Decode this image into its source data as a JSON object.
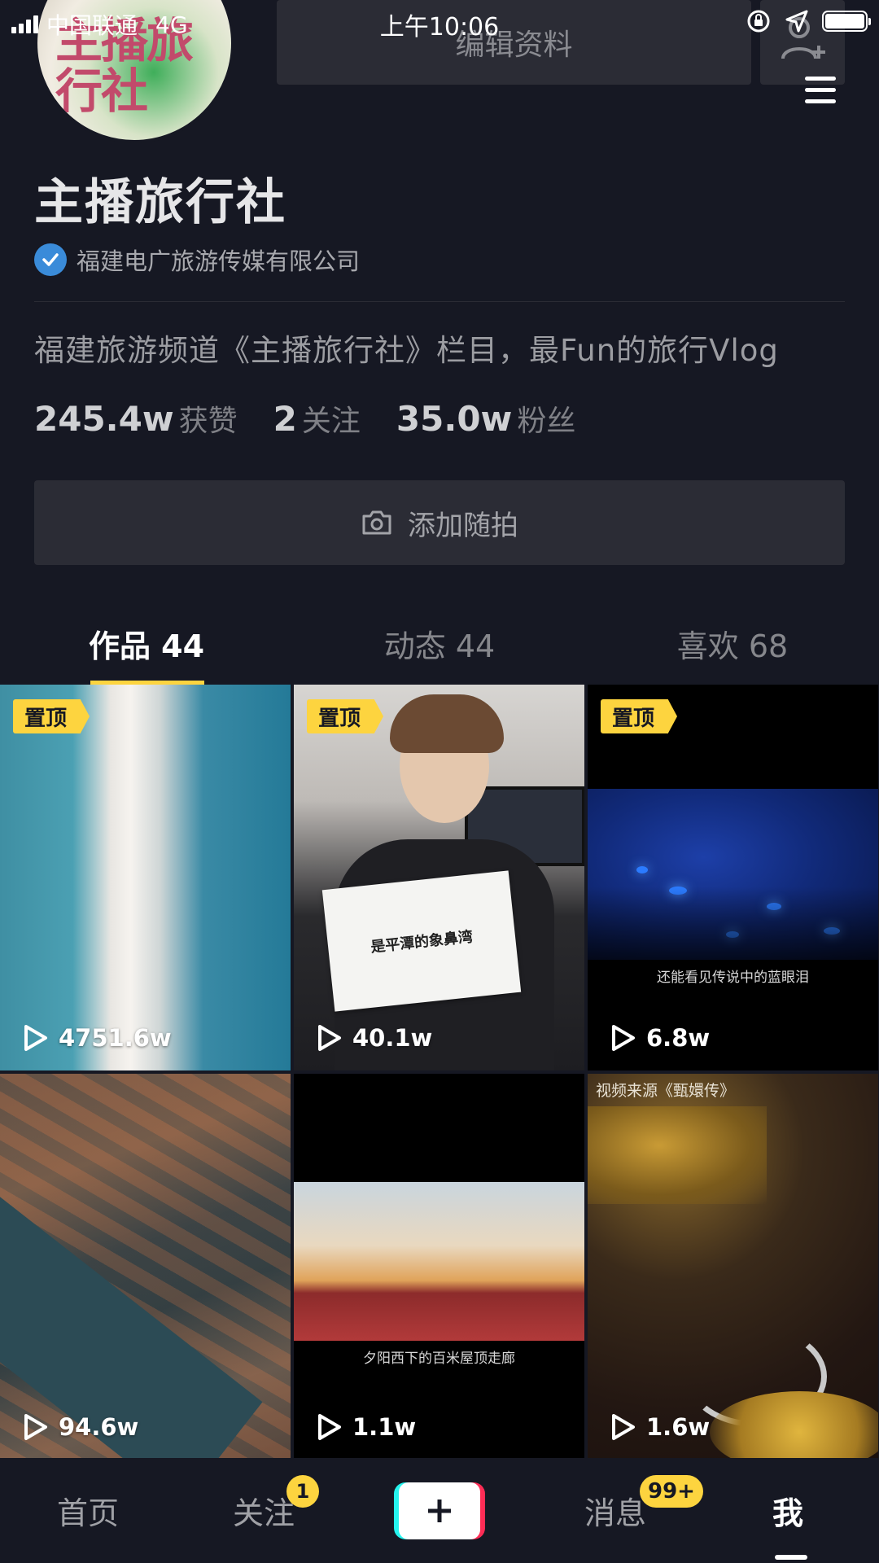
{
  "status_bar": {
    "carrier": "中国联通",
    "network": "4G",
    "time": "上午10:06"
  },
  "header": {
    "avatar_text": "主播旅行社",
    "edit_profile_label": "编辑资料",
    "add_friend_icon": "add-friend-icon",
    "menu_icon": "menu-icon"
  },
  "profile": {
    "name": "主播旅行社",
    "verified_org": "福建电广旅游传媒有限公司",
    "bio": "福建旅游频道《主播旅行社》栏目，最Fun的旅行Vlog",
    "stats": [
      {
        "value": "245.4w",
        "label": "获赞"
      },
      {
        "value": "2",
        "label": "关注"
      },
      {
        "value": "35.0w",
        "label": "粉丝"
      }
    ],
    "add_snap_label": "添加随拍"
  },
  "tabs": [
    {
      "label": "作品 44",
      "active": true
    },
    {
      "label": "动态 44",
      "active": false
    },
    {
      "label": "喜欢 68",
      "active": false
    }
  ],
  "videos": [
    {
      "pinned": true,
      "pin_label": "置顶",
      "plays": "4751.6w",
      "caption": ""
    },
    {
      "pinned": true,
      "pin_label": "置顶",
      "plays": "40.1w",
      "caption": "是平潭的象鼻湾"
    },
    {
      "pinned": true,
      "pin_label": "置顶",
      "plays": "6.8w",
      "caption": "还能看见传说中的蓝眼泪"
    },
    {
      "pinned": false,
      "pin_label": "",
      "plays": "94.6w",
      "caption": ""
    },
    {
      "pinned": false,
      "pin_label": "",
      "plays": "1.1w",
      "caption": "夕阳西下的百米屋顶走廊"
    },
    {
      "pinned": false,
      "pin_label": "",
      "plays": "1.6w",
      "caption": "视频来源《甄嬛传》"
    }
  ],
  "bottom_nav": {
    "home": "首页",
    "follow": "关注",
    "follow_badge": "1",
    "messages": "消息",
    "messages_badge": "99+",
    "me": "我"
  },
  "colors": {
    "background": "#161823",
    "accent": "#fdd43f",
    "button_bg": "#2b2c35",
    "verify_blue": "#3a8bd9"
  }
}
